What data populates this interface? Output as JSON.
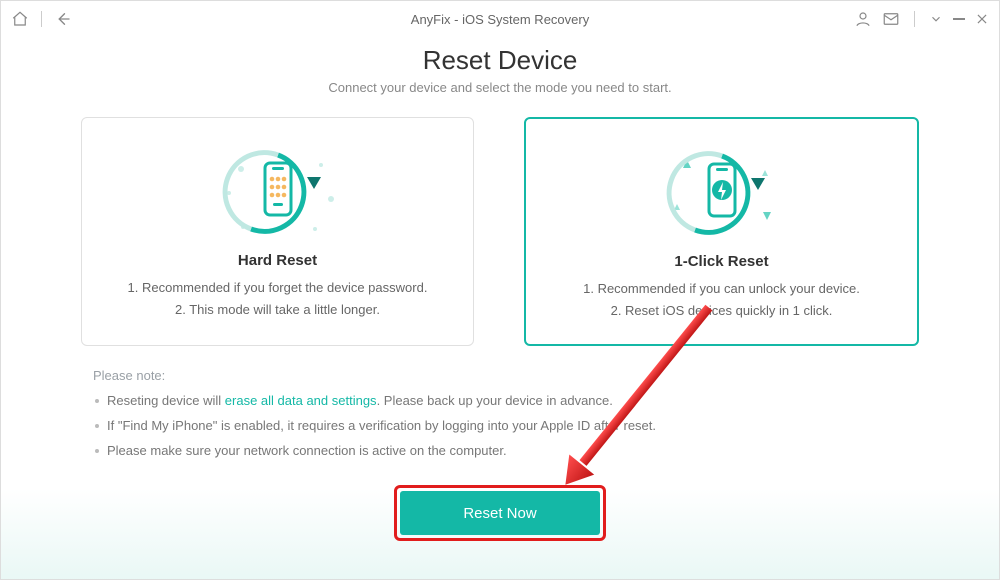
{
  "titlebar": {
    "title": "AnyFix - iOS System Recovery"
  },
  "heading": {
    "title": "Reset Device",
    "subtitle": "Connect your device and select the mode you need to start."
  },
  "cards": {
    "hard": {
      "title": "Hard Reset",
      "line1": "1. Recommended if you forget the device password.",
      "line2": "2. This mode will take a little longer."
    },
    "click": {
      "title": "1-Click Reset",
      "line1": "1. Recommended if you can unlock your device.",
      "line2": "2. Reset iOS devices quickly in 1 click."
    }
  },
  "notes": {
    "label": "Please note:",
    "n1a": "Reseting device will ",
    "n1b": "erase all data and settings",
    "n1c": ". Please back up your device in advance.",
    "n2": "If \"Find My iPhone\" is enabled, it requires a verification by logging into your Apple ID after reset.",
    "n3": "Please make sure your network connection is active on the computer."
  },
  "cta": {
    "label": "Reset Now"
  }
}
